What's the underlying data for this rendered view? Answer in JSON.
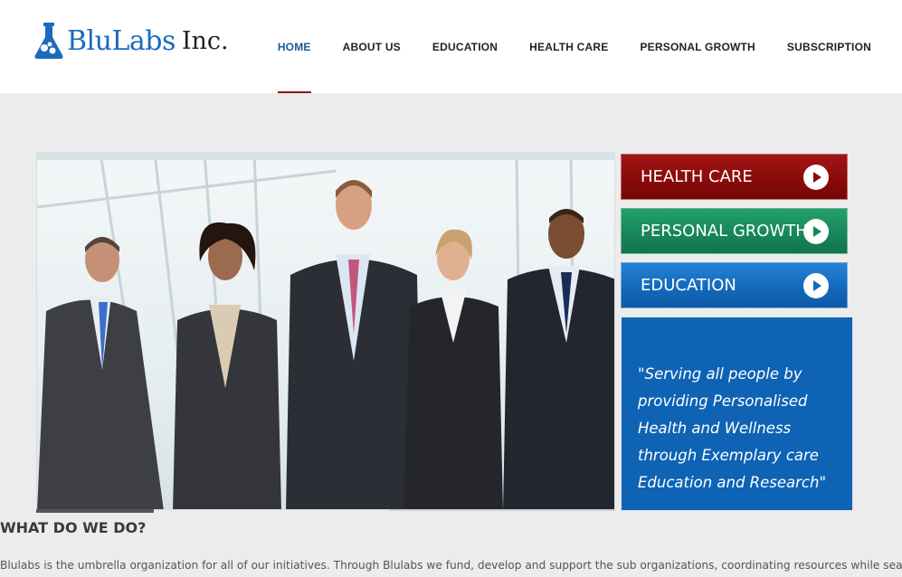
{
  "header": {
    "brand": "BluLabs",
    "brand_suffix": "Inc.",
    "nav": [
      {
        "label": "HOME",
        "active": true
      },
      {
        "label": "ABOUT US",
        "active": false
      },
      {
        "label": "EDUCATION",
        "active": false
      },
      {
        "label": "HEALTH CARE",
        "active": false
      },
      {
        "label": "PERSONAL GROWTH",
        "active": false
      },
      {
        "label": "SUBSCRIPTION",
        "active": false
      }
    ]
  },
  "sidebar": {
    "buttons": [
      {
        "label": "HEALTH CARE",
        "color": "#8a0b0b"
      },
      {
        "label": "PERSONAL GROWTH",
        "color": "#17875a"
      },
      {
        "label": "EDUCATION",
        "color": "#1469bb"
      }
    ],
    "quote": "\"Serving all people by\nproviding Personalised\nHealth and Wellness\nthrough Exemplary care\nEducation and Research\""
  },
  "content": {
    "section_title": "WHAT DO WE DO?",
    "intro": "Blulabs is the umbrella organization for all of our initiatives. Through Blulabs we fund, develop and support the sub organizations, coordinating resources while searching for new a"
  },
  "colors": {
    "brand_blue": "#1a6bbd",
    "nav_active": "#1a5a96",
    "nav_underline": "#8b1a1a",
    "quote_bg": "#0e63b5"
  }
}
